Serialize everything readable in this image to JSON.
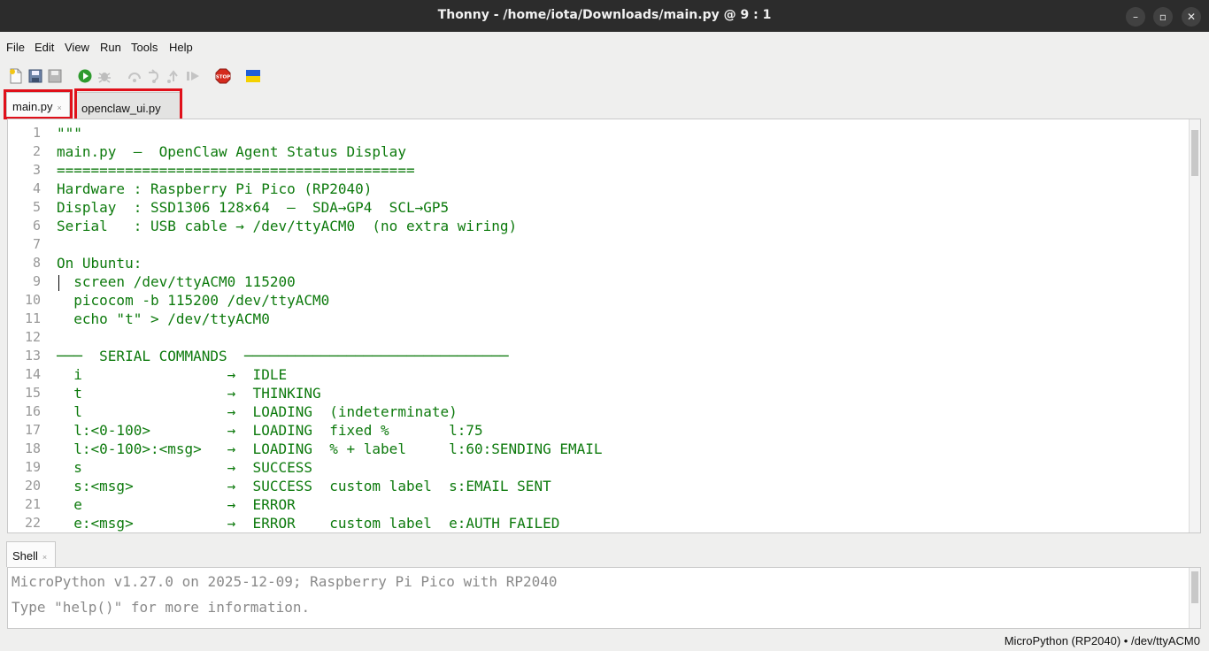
{
  "window": {
    "title": "Thonny  -  /home/iota/Downloads/main.py  @  9 : 1"
  },
  "window_controls": {
    "minimize": "–",
    "maximize": "▫",
    "close": "✕"
  },
  "menu": [
    "File",
    "Edit",
    "View",
    "Run",
    "Tools",
    "Help"
  ],
  "toolbar": {
    "buttons": [
      "new-file",
      "open-file",
      "save-file",
      "run",
      "debug",
      "step-over",
      "step-into",
      "step-out",
      "resume",
      "stop",
      "flag"
    ],
    "stop_label": "STOP",
    "colors": {
      "run": "#2e9a2e",
      "stop": "#d52b1e",
      "flag_top": "#1f5fd6",
      "flag_bottom": "#f4d100"
    }
  },
  "tabs": [
    {
      "label": "main.py",
      "active": true,
      "close": "×"
    },
    {
      "label": "openclaw_ui.py",
      "active": false,
      "close": ""
    }
  ],
  "highlight_color": "#e0101a",
  "editor": {
    "text_color": "#0d7a0d",
    "lines": [
      {
        "n": "1",
        "text": "\"\"\""
      },
      {
        "n": "2",
        "text": "main.py  –  OpenClaw Agent Status Display"
      },
      {
        "n": "3",
        "text": "=========================================="
      },
      {
        "n": "4",
        "text": "Hardware : Raspberry Pi Pico (RP2040)"
      },
      {
        "n": "5",
        "text": "Display  : SSD1306 128×64  –  SDA→GP4  SCL→GP5"
      },
      {
        "n": "6",
        "text": "Serial   : USB cable → /dev/ttyACM0  (no extra wiring)"
      },
      {
        "n": "7",
        "text": ""
      },
      {
        "n": "8",
        "text": "On Ubuntu:"
      },
      {
        "n": "9",
        "text": "  screen /dev/ttyACM0 115200"
      },
      {
        "n": "10",
        "text": "  picocom -b 115200 /dev/ttyACM0"
      },
      {
        "n": "11",
        "text": "  echo \"t\" > /dev/ttyACM0"
      },
      {
        "n": "12",
        "text": ""
      },
      {
        "n": "13",
        "text": "───  SERIAL COMMANDS  ───────────────────────────────"
      },
      {
        "n": "14",
        "text": "  i                 →  IDLE"
      },
      {
        "n": "15",
        "text": "  t                 →  THINKING"
      },
      {
        "n": "16",
        "text": "  l                 →  LOADING  (indeterminate)"
      },
      {
        "n": "17",
        "text": "  l:<0-100>         →  LOADING  fixed %       l:75"
      },
      {
        "n": "18",
        "text": "  l:<0-100>:<msg>   →  LOADING  % + label     l:60:SENDING EMAIL"
      },
      {
        "n": "19",
        "text": "  s                 →  SUCCESS"
      },
      {
        "n": "20",
        "text": "  s:<msg>           →  SUCCESS  custom label  s:EMAIL SENT"
      },
      {
        "n": "21",
        "text": "  e                 →  ERROR"
      },
      {
        "n": "22",
        "text": "  e:<msg>           →  ERROR    custom label  e:AUTH FAILED"
      }
    ]
  },
  "shell": {
    "tab_label": "Shell",
    "tab_close": "×",
    "lines": [
      "MicroPython v1.27.0 on 2025-12-09; Raspberry Pi Pico with RP2040",
      "Type \"help()\" for more information.",
      ">>>"
    ]
  },
  "status": {
    "interpreter": "MicroPython (RP2040)  •  /dev/ttyACM0"
  }
}
